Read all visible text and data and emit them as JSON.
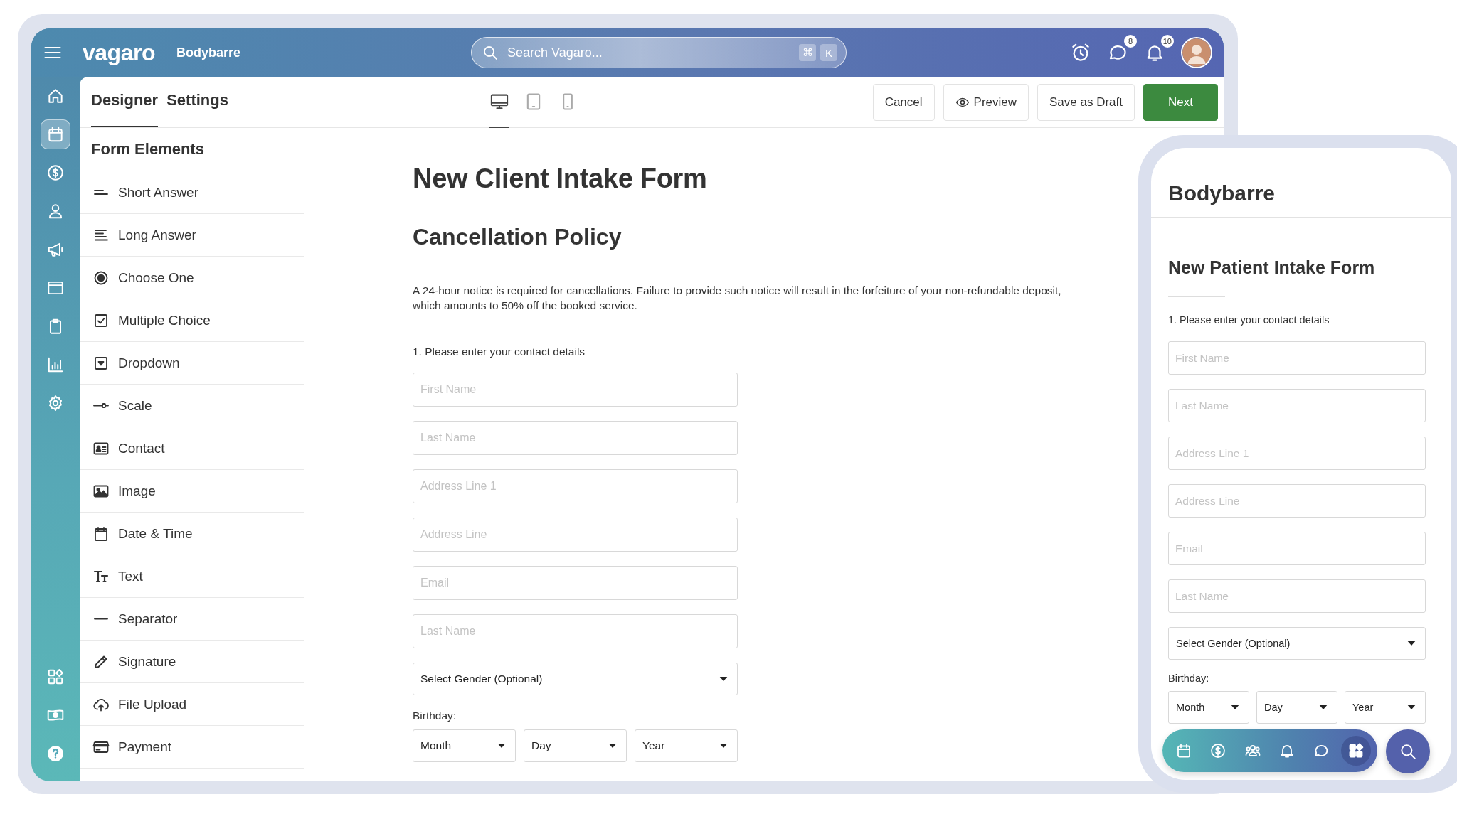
{
  "topbar": {
    "brand": "vagaro",
    "business": "Bodybarre",
    "search": {
      "placeholder": "Search Vagaro...",
      "keys": [
        "⌘",
        "K"
      ]
    },
    "actions": [
      {
        "kind": "alarm"
      },
      {
        "kind": "chat",
        "badge": "8"
      },
      {
        "kind": "bell",
        "badge": "10"
      },
      {
        "kind": "avatar"
      }
    ]
  },
  "rail": {
    "items": [
      {
        "kind": "home",
        "selected": false
      },
      {
        "kind": "calendar",
        "selected": true
      },
      {
        "kind": "dollar",
        "selected": false
      },
      {
        "kind": "person",
        "selected": false
      },
      {
        "kind": "megaphone",
        "selected": false
      },
      {
        "kind": "browser",
        "selected": false
      },
      {
        "kind": "clipboard",
        "selected": false
      },
      {
        "kind": "chart",
        "selected": false
      },
      {
        "kind": "gear",
        "selected": false
      }
    ],
    "bottom_items": [
      {
        "kind": "apps",
        "selected": false
      },
      {
        "kind": "cash",
        "selected": false
      },
      {
        "kind": "help",
        "selected": false
      }
    ]
  },
  "header": {
    "tabs": [
      {
        "label": "Designer",
        "selected": true
      },
      {
        "label": "Settings",
        "selected": false
      }
    ],
    "devices": [
      {
        "kind": "desktop",
        "selected": true
      },
      {
        "kind": "tablet",
        "selected": false
      },
      {
        "kind": "phone",
        "selected": false
      }
    ],
    "buttons": [
      {
        "label": "Cancel",
        "kind": "plain"
      },
      {
        "label": "Preview",
        "kind": "preview"
      },
      {
        "label": "Save as Draft",
        "kind": "plain"
      },
      {
        "label": "Next",
        "kind": "primary"
      }
    ]
  },
  "form_elements": {
    "title": "Form Elements",
    "items": [
      {
        "label": "Short Answer",
        "kind": "short"
      },
      {
        "label": "Long Answer",
        "kind": "long"
      },
      {
        "label": "Choose One",
        "kind": "radio"
      },
      {
        "label": "Multiple Choice",
        "kind": "checkbox"
      },
      {
        "label": "Dropdown",
        "kind": "dropdown"
      },
      {
        "label": "Scale",
        "kind": "scale"
      },
      {
        "label": "Contact",
        "kind": "contact"
      },
      {
        "label": "Image",
        "kind": "image"
      },
      {
        "label": "Date & Time",
        "kind": "date"
      },
      {
        "label": "Text",
        "kind": "text"
      },
      {
        "label": "Separator",
        "kind": "separator"
      },
      {
        "label": "Signature",
        "kind": "signature"
      },
      {
        "label": "File Upload",
        "kind": "upload"
      },
      {
        "label": "Payment",
        "kind": "payment"
      }
    ]
  },
  "canvas": {
    "title": "New Client Intake Form",
    "section": "Cancellation Policy",
    "policy": "A 24-hour notice is required for cancellations. Failure to provide such notice will result in the forfeiture of your non-refundable deposit, which amounts to 50% off the booked service.",
    "question": "1. Please enter your contact details",
    "fields": [
      {
        "placeholder": "First Name"
      },
      {
        "placeholder": "Last Name"
      },
      {
        "placeholder": "Address Line 1"
      },
      {
        "placeholder": "Address Line"
      },
      {
        "placeholder": "Email"
      },
      {
        "placeholder": "Last Name"
      }
    ],
    "gender_select": "Select Gender (Optional)",
    "birthday_label": "Birthday:",
    "birthday_selects": [
      "Month",
      "Day",
      "Year"
    ]
  },
  "phone": {
    "business": "Bodybarre",
    "title": "New Patient Intake Form",
    "question": "1. Please enter your contact details",
    "fields": [
      {
        "placeholder": "First Name"
      },
      {
        "placeholder": "Last Name"
      },
      {
        "placeholder": "Address Line 1"
      },
      {
        "placeholder": "Address Line"
      },
      {
        "placeholder": "Email"
      },
      {
        "placeholder": "Last Name"
      }
    ],
    "gender_select": "Select Gender (Optional)",
    "birthday_label": "Birthday:",
    "birthday_selects": [
      "Month",
      "Day",
      "Year"
    ],
    "nav": [
      {
        "kind": "calendar",
        "selected": false
      },
      {
        "kind": "dollar",
        "selected": false
      },
      {
        "kind": "people",
        "selected": false
      },
      {
        "kind": "bell",
        "selected": false
      },
      {
        "kind": "chat",
        "selected": false
      },
      {
        "kind": "apps",
        "selected": true
      }
    ]
  }
}
